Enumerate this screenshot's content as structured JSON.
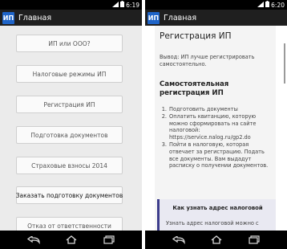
{
  "status": {
    "left_time": "6:19",
    "right_time": "6:20"
  },
  "app": {
    "logo": "ИП",
    "title": "Главная"
  },
  "left_menu": {
    "items": [
      {
        "label": "ИП или ООО?"
      },
      {
        "label": "Налоговые режимы ИП"
      },
      {
        "label": "Регистрация ИП"
      },
      {
        "label": "Подготовка документов"
      },
      {
        "label": "Страховые взносы 2014"
      },
      {
        "label": "Заказать подготовку документов"
      },
      {
        "label": "Отказ от ответственности"
      }
    ]
  },
  "article": {
    "title": "Регистрация ИП",
    "conclusion_line1": "Вывод: ИП лучше регистрировать",
    "conclusion_line2": "самостоятельно.",
    "subheading_line1": "Самостоятельная",
    "subheading_line2": "регистрация ИП",
    "steps": [
      {
        "num": "1.",
        "lines": [
          "Подготовить документы"
        ]
      },
      {
        "num": "2.",
        "lines": [
          "Оплатить квитанцию, которую",
          "можно сформировать на сайте",
          "налоговой:",
          "https://service.nalog.ru/gp2.do"
        ]
      },
      {
        "num": "3.",
        "lines": [
          "Пойти в налоговую, которая",
          "отвечает за регистрацию. Подать",
          "все документы. Вам выдадут",
          "расписку о получении документов."
        ]
      }
    ],
    "note_title": "Как узнать адрес налоговой",
    "note_text": "Узнать адрес налоговой можно с"
  },
  "icons": {
    "signal": "signal-icon",
    "battery": "battery-icon",
    "back": "back-icon",
    "home": "home-icon",
    "recent": "recent-apps-icon"
  }
}
